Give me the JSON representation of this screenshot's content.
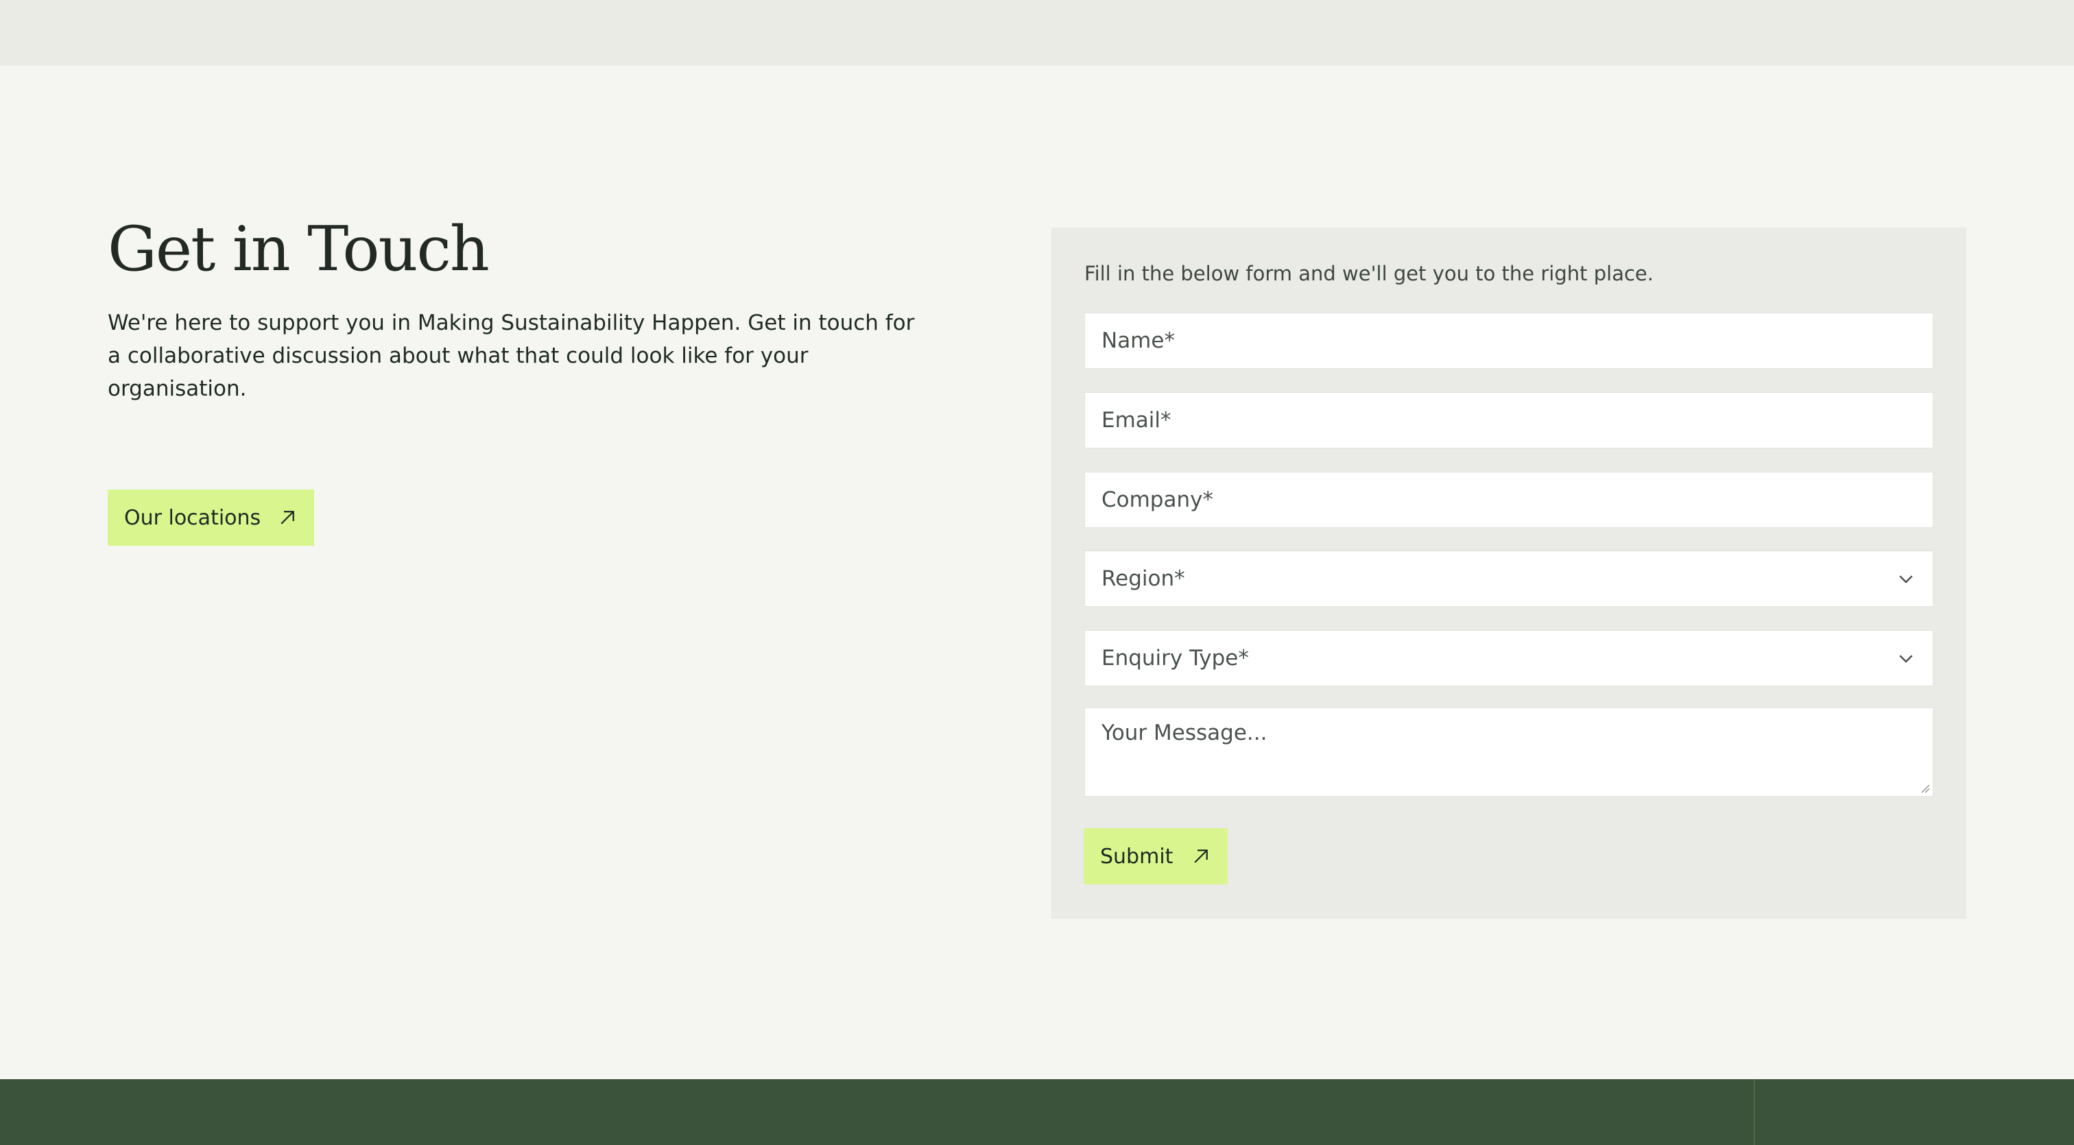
{
  "contact": {
    "heading": "Get in Touch",
    "intro": "We're here to support you in Making Sustainability Happen. Get in touch for a collaborative discussion about what that could look like for your organisation.",
    "locations_button": "Our locations"
  },
  "form": {
    "intro": "Fill in the below form and we'll get you to the right place.",
    "name_placeholder": "Name*",
    "email_placeholder": "Email*",
    "company_placeholder": "Company*",
    "region_placeholder": "Region*",
    "enquiry_placeholder": "Enquiry Type*",
    "message_placeholder": "Your Message...",
    "submit_label": "Submit"
  },
  "icons": {
    "arrow": "arrow-up-right-icon",
    "dropdown": "chevron-down-icon"
  },
  "colors": {
    "accent": "#d8f58e",
    "footer": "#3b533b",
    "panel": "#eaebe6",
    "background": "#f5f6f1"
  }
}
